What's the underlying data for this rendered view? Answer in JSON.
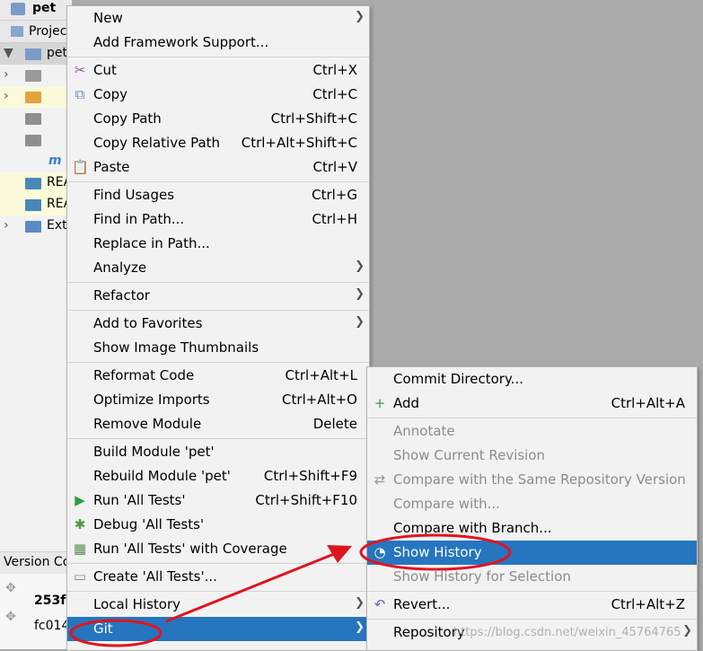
{
  "project": {
    "name": "pet",
    "tab_label": "Project"
  },
  "tree": [
    {
      "arrow": "▼",
      "label": "pet",
      "icon_color": "#7a9cc8",
      "style": "sel"
    },
    {
      "arrow": "›",
      "label": "",
      "icon_color": "#9a9a9a",
      "style": ""
    },
    {
      "arrow": "›",
      "label": "",
      "icon_color": "#e8a23c",
      "style": "hl"
    },
    {
      "arrow": "",
      "label": "",
      "icon_color": "#8f8f8f",
      "style": ""
    },
    {
      "arrow": "",
      "label": "",
      "icon_color": "#8f8f8f",
      "style": ""
    },
    {
      "arrow": "",
      "label": "m",
      "icon_color": "",
      "style": ""
    },
    {
      "arrow": "",
      "label": "REA",
      "icon_color": "#4a87b8",
      "style": "hl"
    },
    {
      "arrow": "",
      "label": "REA",
      "icon_color": "#4a87b8",
      "style": "hl"
    },
    {
      "arrow": "›",
      "label": "Ext",
      "icon_color": "#5a8ac6",
      "style": ""
    }
  ],
  "version_control": {
    "tab_label": "Version Co",
    "commit_hash": "253f",
    "commit_hash2": "fc014"
  },
  "context_menu": [
    {
      "label": "New",
      "shortcut": "",
      "submenu": true,
      "icon": ""
    },
    {
      "label": "Add Framework Support...",
      "shortcut": "",
      "submenu": false,
      "icon": ""
    },
    {
      "sep": true
    },
    {
      "label": "Cut",
      "shortcut": "Ctrl+X",
      "submenu": false,
      "icon": "✂"
    },
    {
      "label": "Copy",
      "shortcut": "Ctrl+C",
      "submenu": false,
      "icon": "⧉"
    },
    {
      "label": "Copy Path",
      "shortcut": "Ctrl+Shift+C",
      "submenu": false,
      "icon": ""
    },
    {
      "label": "Copy Relative Path",
      "shortcut": "Ctrl+Alt+Shift+C",
      "submenu": false,
      "icon": ""
    },
    {
      "label": "Paste",
      "shortcut": "Ctrl+V",
      "submenu": false,
      "icon": "📋"
    },
    {
      "sep": true
    },
    {
      "label": "Find Usages",
      "shortcut": "Ctrl+G",
      "submenu": false,
      "icon": ""
    },
    {
      "label": "Find in Path...",
      "shortcut": "Ctrl+H",
      "submenu": false,
      "icon": ""
    },
    {
      "label": "Replace in Path...",
      "shortcut": "",
      "submenu": false,
      "icon": ""
    },
    {
      "label": "Analyze",
      "shortcut": "",
      "submenu": true,
      "icon": ""
    },
    {
      "sep": true
    },
    {
      "label": "Refactor",
      "shortcut": "",
      "submenu": true,
      "icon": ""
    },
    {
      "sep": true
    },
    {
      "label": "Add to Favorites",
      "shortcut": "",
      "submenu": true,
      "icon": ""
    },
    {
      "label": "Show Image Thumbnails",
      "shortcut": "",
      "submenu": false,
      "icon": ""
    },
    {
      "sep": true
    },
    {
      "label": "Reformat Code",
      "shortcut": "Ctrl+Alt+L",
      "submenu": false,
      "icon": ""
    },
    {
      "label": "Optimize Imports",
      "shortcut": "Ctrl+Alt+O",
      "submenu": false,
      "icon": ""
    },
    {
      "label": "Remove Module",
      "shortcut": "Delete",
      "submenu": false,
      "icon": ""
    },
    {
      "sep": true
    },
    {
      "label": "Build Module 'pet'",
      "shortcut": "",
      "submenu": false,
      "icon": ""
    },
    {
      "label": "Rebuild Module 'pet'",
      "shortcut": "Ctrl+Shift+F9",
      "submenu": false,
      "icon": ""
    },
    {
      "label": "Run 'All Tests'",
      "shortcut": "Ctrl+Shift+F10",
      "submenu": false,
      "icon": "▶"
    },
    {
      "label": "Debug 'All Tests'",
      "shortcut": "",
      "submenu": false,
      "icon": "✱"
    },
    {
      "label": "Run 'All Tests' with Coverage",
      "shortcut": "",
      "submenu": false,
      "icon": "▦"
    },
    {
      "sep": true
    },
    {
      "label": "Create 'All Tests'...",
      "shortcut": "",
      "submenu": false,
      "icon": "▭"
    },
    {
      "sep": true
    },
    {
      "label": "Local History",
      "shortcut": "",
      "submenu": true,
      "icon": ""
    },
    {
      "label": "Git",
      "shortcut": "",
      "submenu": true,
      "icon": "",
      "active": true
    }
  ],
  "git_menu": [
    {
      "label": "Commit Directory...",
      "shortcut": "",
      "submenu": false,
      "icon": ""
    },
    {
      "label": "Add",
      "shortcut": "Ctrl+Alt+A",
      "submenu": false,
      "icon": "+"
    },
    {
      "sep": true
    },
    {
      "label": "Annotate",
      "shortcut": "",
      "submenu": false,
      "icon": "",
      "disabled": true
    },
    {
      "label": "Show Current Revision",
      "shortcut": "",
      "submenu": false,
      "icon": "",
      "disabled": true
    },
    {
      "label": "Compare with the Same Repository Version",
      "shortcut": "",
      "submenu": false,
      "icon": "⇄",
      "disabled": true
    },
    {
      "label": "Compare with...",
      "shortcut": "",
      "submenu": false,
      "icon": "",
      "disabled": true
    },
    {
      "label": "Compare with Branch...",
      "shortcut": "",
      "submenu": false,
      "icon": ""
    },
    {
      "label": "Show History",
      "shortcut": "",
      "submenu": false,
      "icon": "◔",
      "active": true
    },
    {
      "label": "Show History for Selection",
      "shortcut": "",
      "submenu": false,
      "icon": "",
      "disabled": true
    },
    {
      "sep": true
    },
    {
      "label": "Revert...",
      "shortcut": "Ctrl+Alt+Z",
      "submenu": false,
      "icon": "↶"
    },
    {
      "sep": true
    },
    {
      "label": "Repository",
      "shortcut": "",
      "submenu": true,
      "icon": ""
    }
  ],
  "watermark": "https://blog.csdn.net/weixin_45764765",
  "colors": {
    "highlight": "#2675bf",
    "annotation": "#e0141e",
    "menu_bg": "#f2f2f2"
  }
}
